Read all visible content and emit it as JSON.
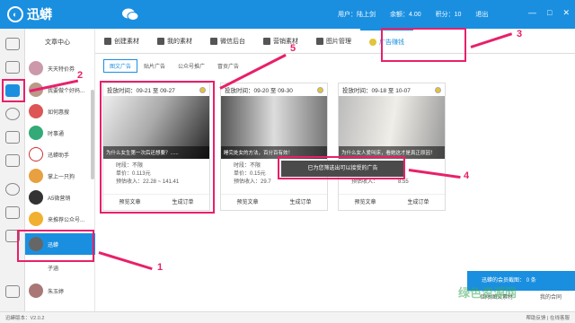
{
  "app": {
    "name": "迅蟒"
  },
  "user": {
    "label_user": "用户：",
    "name": "陆上剑",
    "balance_label": "余额：",
    "balance": "4.00",
    "points_label": "积分：",
    "points": "10",
    "logout": "退出"
  },
  "sidebar": {
    "title": "文章中心",
    "items": [
      {
        "label": "天天特价券"
      },
      {
        "label": "我要做个好妈..."
      },
      {
        "label": "如何惠搜"
      },
      {
        "label": "时事通"
      },
      {
        "label": "迅蟒助手"
      },
      {
        "label": "掌上一只狗"
      },
      {
        "label": "A5微营销"
      },
      {
        "label": "来推荐公众号..."
      },
      {
        "label": "迅蟒"
      },
      {
        "label": "子涵"
      },
      {
        "label": "朱玉婷"
      }
    ]
  },
  "tabs": [
    {
      "label": "创建素材"
    },
    {
      "label": "我的素材"
    },
    {
      "label": "微信后台"
    },
    {
      "label": "营销素材"
    },
    {
      "label": "图片管理"
    },
    {
      "label": "广告赚钱"
    }
  ],
  "subtabs": [
    {
      "label": "图文广告"
    },
    {
      "label": "贴片广告"
    },
    {
      "label": "公众号推广"
    },
    {
      "label": "冒贡广告"
    }
  ],
  "cards": [
    {
      "period": "投放时间：09-21 至 09-27",
      "caption": "为什么女生第一次后还想要？......",
      "time": "时段：不限",
      "price": "单价：0.113元",
      "income": "预估收入：22.28 ~ 141.41",
      "preview": "预览文章",
      "order": "生成订单"
    },
    {
      "period": "投放时间：09-20 至 09-30",
      "caption": "睡完处女的方法，百分百有效！",
      "time": "时段：不限",
      "price": "单价：0.15元",
      "income": "预估收入：29.7",
      "preview": "预览文章",
      "order": "生成订单"
    },
    {
      "period": "投放时间：09-18 至 10-07",
      "caption": "为什么女人爱叫床，看她这才是真正原因！",
      "time": "时段：",
      "price": "单价：0.15元",
      "income": "预估收入：",
      "income_tail": "8.55",
      "preview": "预览文章",
      "order": "生成订单"
    }
  ],
  "tooltip": "已为您筛选出可以接受的广告",
  "annotations": [
    "1",
    "2",
    "3",
    "4",
    "5"
  ],
  "promo": {
    "title": "迅蟒的会员截图：",
    "count": "0 条",
    "left": "回收图文素材",
    "right": "我的合同"
  },
  "status": {
    "version": "迅蟒版本：V2.0.2",
    "help": "帮助反馈",
    "online": "在线客服"
  },
  "watermark": "绿色资源网"
}
